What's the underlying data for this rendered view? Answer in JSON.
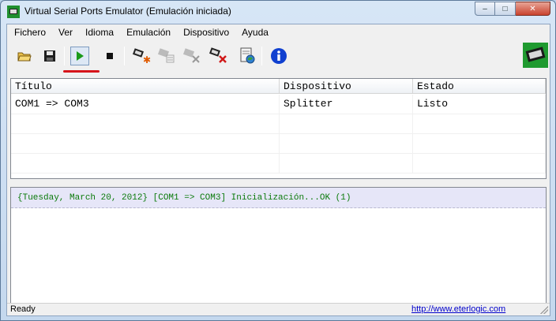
{
  "window": {
    "title": "Virtual Serial Ports Emulator (Emulación iniciada)",
    "buttons": {
      "minimize": "–",
      "maximize": "□",
      "close": "✕"
    }
  },
  "menu": [
    "Fichero",
    "Ver",
    "Idioma",
    "Emulación",
    "Dispositivo",
    "Ayuda"
  ],
  "toolbar": {
    "icons": [
      "open-folder-icon",
      "save-icon",
      "play-icon",
      "stop-icon",
      "create-device-icon",
      "edit-device-icon",
      "device-disabled-icon",
      "delete-device-icon",
      "device-settings-icon",
      "info-icon"
    ],
    "pressed": "play-icon",
    "play_color": "#1a9a1a"
  },
  "ports": {
    "columns": [
      "Título",
      "Dispositivo",
      "Estado"
    ],
    "rows": [
      [
        "COM1 => COM3",
        "Splitter",
        "Listo"
      ]
    ]
  },
  "log": {
    "lines": [
      "{Tuesday, March 20, 2012} [COM1 => COM3] Inicialización...OK (1)"
    ]
  },
  "status": {
    "text": "Ready",
    "link": "http://www.eterlogic.com"
  }
}
